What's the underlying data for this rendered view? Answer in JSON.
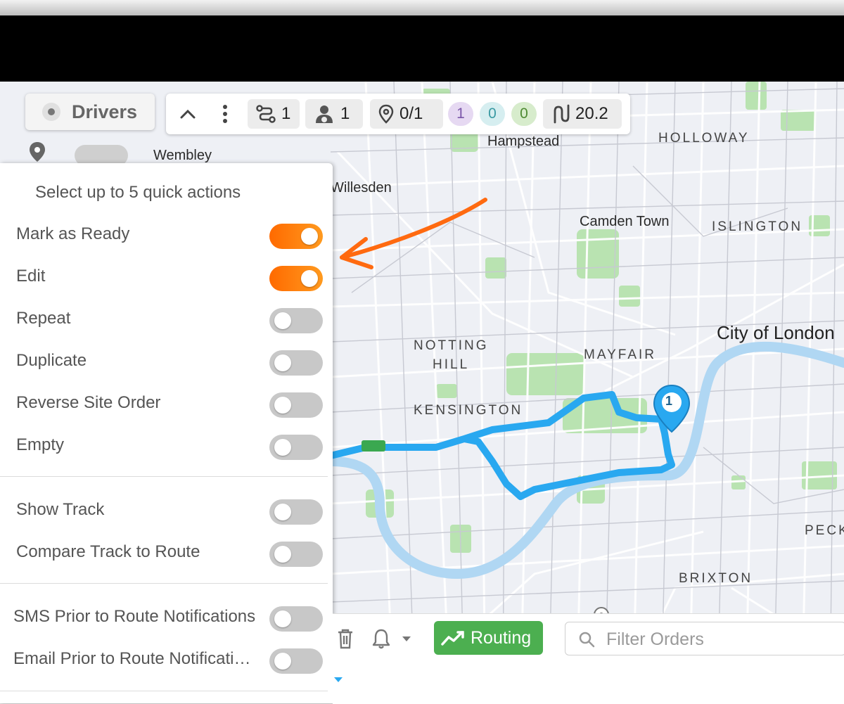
{
  "header": {
    "title": "Drivers"
  },
  "stats": {
    "routes": "1",
    "drivers": "1",
    "stops": "0/1",
    "pill_purple": "1",
    "pill_teal": "0",
    "pill_green": "0",
    "distance": "20.2"
  },
  "map": {
    "labels": {
      "hampstead": "Hampstead",
      "holloway": "HOLLOWAY",
      "wembley": "Wembley",
      "willesden": "Willesden",
      "camden": "Camden Town",
      "islington": "ISLINGTON",
      "city": "City of London",
      "notting1": "NOTTING",
      "notting2": "HILL",
      "mayfair": "MAYFAIR",
      "kensington": "KENSINGTON",
      "peckham": "PECK",
      "brixton": "BRIXTON"
    },
    "marker_number": "1"
  },
  "panel": {
    "heading": "Select up to 5 quick actions",
    "group1": [
      {
        "label": "Mark as Ready",
        "on": true
      },
      {
        "label": "Edit",
        "on": true
      },
      {
        "label": "Repeat",
        "on": false
      },
      {
        "label": "Duplicate",
        "on": false
      },
      {
        "label": "Reverse Site Order",
        "on": false
      },
      {
        "label": "Empty",
        "on": false
      }
    ],
    "group2": [
      {
        "label": "Show Track",
        "on": false
      },
      {
        "label": "Compare Track to Route",
        "on": false
      }
    ],
    "group3": [
      {
        "label": "SMS Prior to Route Notifications",
        "on": false
      },
      {
        "label": "Email Prior to Route Notifications",
        "on": false
      }
    ]
  },
  "toolbar": {
    "routing_label": "Routing",
    "filter_placeholder": "Filter Orders"
  },
  "colors": {
    "toggle_on": "#ff7a00",
    "route_line": "#29a8f0",
    "routing_button": "#4caf50",
    "annotation_arrow": "#ff6a10"
  }
}
